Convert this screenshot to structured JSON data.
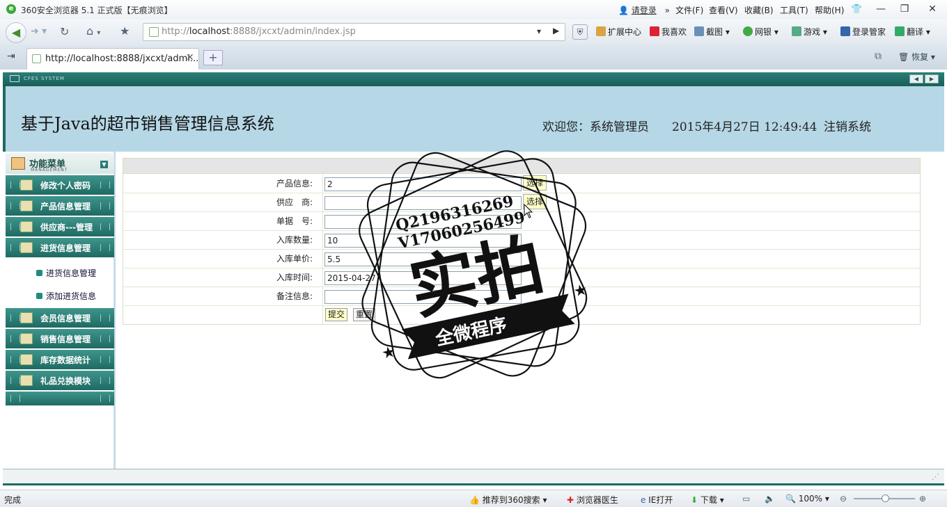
{
  "browser": {
    "title": "360安全浏览器 5.1 正式版【无痕浏览】",
    "login": "请登录",
    "menu": [
      "文件(F)",
      "查看(V)",
      "收藏(B)",
      "工具(T)",
      "帮助(H)"
    ],
    "url_prefix": "http://",
    "url_host": "localhost",
    "url_rest": ":8888/jxcxt/admin/index.jsp",
    "toolbar": [
      "扩展中心",
      "我喜欢",
      "截图",
      "网银",
      "游戏",
      "登录管家",
      "翻译"
    ],
    "tab_title": "http://localhost:8888/jxcxt/admi...",
    "restore": "恢复",
    "accent": "#1d6a64"
  },
  "app": {
    "brand": "CFES SYSTEM",
    "system_title": "基于Java的超市销售管理信息系统",
    "welcome": "欢迎您：系统管理员",
    "datetime": "2015年4月27日  12:49:44",
    "logout": "注销系统",
    "menu_title": "功能菜单",
    "menu_sub": "MANAGEMENT",
    "menu_items": [
      "修改个人密码",
      "产品信息管理",
      "供应商---管理",
      "进货信息管理"
    ],
    "sub_items": [
      "进货信息管理",
      "添加进货信息"
    ],
    "menu_items2": [
      "会员信息管理",
      "销售信息管理",
      "库存数据统计",
      "礼品兑换模块"
    ]
  },
  "form": {
    "rows": [
      {
        "label": "产品信息:",
        "value": "2",
        "select": "选择"
      },
      {
        "label": "供应　商:",
        "value": "",
        "select": "选择"
      },
      {
        "label": "单据　号:",
        "value": ""
      },
      {
        "label": "入库数量:",
        "value": "10"
      },
      {
        "label": "入库单价:",
        "value": "5.5"
      },
      {
        "label": "入库时间:",
        "value": "2015-04-27"
      },
      {
        "label": "备注信息:",
        "value": ""
      }
    ],
    "submit": "提交",
    "reset": "重置"
  },
  "stamp": {
    "line1": "Q2196316269",
    "line2": "V17060256499",
    "main": "实拍",
    "ribbon": "全微程序"
  },
  "status": {
    "done": "完成",
    "items": [
      "推荐到360搜索",
      "浏览器医生",
      "IE打开",
      "下载"
    ],
    "zoom": "100%"
  }
}
